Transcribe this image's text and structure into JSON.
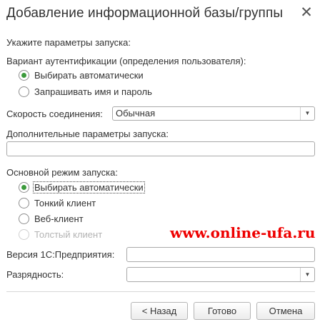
{
  "dialog": {
    "title": "Добавление информационной базы/группы",
    "close_glyph": "✕"
  },
  "launch_params_label": "Укажите параметры запуска:",
  "auth": {
    "label": "Вариант аутентификации (определения пользователя):",
    "options": [
      {
        "label": "Выбирать автоматически",
        "checked": true
      },
      {
        "label": "Запрашивать имя и пароль",
        "checked": false
      }
    ]
  },
  "speed": {
    "label": "Скорость соединения:",
    "value": "Обычная",
    "dropdown_glyph": "▼"
  },
  "extra_params": {
    "label": "Дополнительные параметры запуска:",
    "value": ""
  },
  "launch_mode": {
    "label": "Основной режим запуска:",
    "options": [
      {
        "label": "Выбирать автоматически",
        "checked": true
      },
      {
        "label": "Тонкий клиент",
        "checked": false
      },
      {
        "label": "Веб-клиент",
        "checked": false
      },
      {
        "label": "Толстый клиент",
        "checked": false,
        "disabled": true
      }
    ]
  },
  "version": {
    "label": "Версия 1С:Предприятия:",
    "value": ""
  },
  "bitness": {
    "label": "Разрядность:",
    "value": "",
    "dropdown_glyph": "▼"
  },
  "buttons": {
    "back": "< Назад",
    "done": "Готово",
    "cancel": "Отмена"
  },
  "watermark": "www.online-ufa.ru",
  "colors": {
    "radio_checked": "#3c9a3c",
    "watermark": "#ee0000"
  }
}
